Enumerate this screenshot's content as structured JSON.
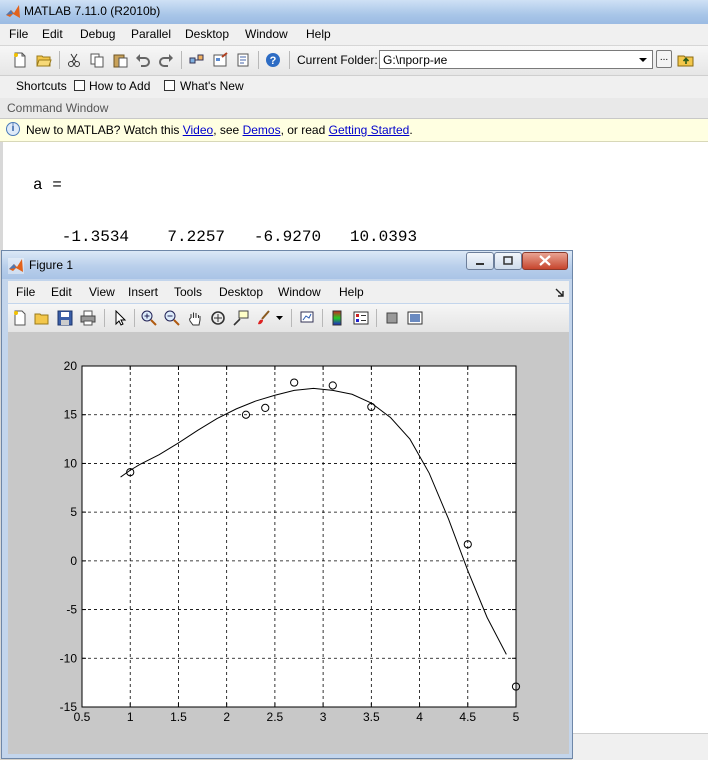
{
  "app": {
    "title": "MATLAB  7.11.0 (R2010b)"
  },
  "menu": [
    "File",
    "Edit",
    "Debug",
    "Parallel",
    "Desktop",
    "Window",
    "Help"
  ],
  "toolbar": {
    "current_folder_label": "Current Folder:",
    "current_folder_value": "G:\\прогр-ие",
    "browse_label": "..."
  },
  "shortcuts": {
    "items": [
      "Shortcuts",
      "How to Add",
      "What's New"
    ]
  },
  "command_window": {
    "header": "Command Window",
    "info": {
      "prefix": "New to MATLAB? Watch this ",
      "link1": "Video",
      "mid1": ", see ",
      "link2": "Demos",
      "mid2": ", or read ",
      "link3": "Getting Started",
      "suffix": "."
    },
    "lines": [
      "a =",
      "   -1.3534    7.2257   -6.9270   10.0393"
    ]
  },
  "figure": {
    "title": "Figure 1",
    "menu": [
      "File",
      "Edit",
      "View",
      "Insert",
      "Tools",
      "Desktop",
      "Window",
      "Help"
    ]
  },
  "chart_data": {
    "type": "scatter",
    "title": "",
    "xlabel": "",
    "ylabel": "",
    "xlim": [
      0.5,
      5
    ],
    "ylim": [
      -15,
      20
    ],
    "xticks": [
      0.5,
      1,
      1.5,
      2,
      2.5,
      3,
      3.5,
      4,
      4.5,
      5
    ],
    "xtick_labels": [
      "0.5",
      "1",
      "1.5",
      "2",
      "2.5",
      "3",
      "3.5",
      "4",
      "4.5",
      "5"
    ],
    "yticks": [
      -15,
      -10,
      -5,
      0,
      5,
      10,
      15,
      20
    ],
    "ytick_labels": [
      "-15",
      "-10",
      "-5",
      "0",
      "5",
      "10",
      "15",
      "20"
    ],
    "grid": true,
    "series": [
      {
        "style": "markers-circle",
        "x": [
          1.0,
          2.2,
          2.4,
          2.7,
          3.1,
          3.5,
          4.5,
          5.0
        ],
        "y": [
          9.1,
          15.0,
          15.7,
          18.3,
          18.0,
          15.8,
          1.7,
          -12.9
        ]
      },
      {
        "style": "line",
        "x": [
          0.9,
          1.0,
          1.1,
          1.3,
          1.5,
          1.7,
          1.9,
          2.1,
          2.3,
          2.5,
          2.7,
          2.9,
          3.1,
          3.3,
          3.5,
          3.7,
          3.9,
          4.1,
          4.3,
          4.5,
          4.7,
          4.9
        ],
        "y": [
          8.6,
          9.3,
          9.9,
          10.9,
          12.1,
          13.4,
          14.6,
          15.6,
          16.4,
          17.0,
          17.5,
          17.7,
          17.5,
          17.1,
          16.2,
          14.7,
          12.5,
          9.0,
          4.3,
          -1.0,
          -5.8,
          -9.6
        ]
      }
    ]
  },
  "colors": {
    "link": "#0000cc",
    "info_bg": "#ffffe1",
    "plot_bg": "#ffffff",
    "figure_bg": "#c8c8c8"
  }
}
